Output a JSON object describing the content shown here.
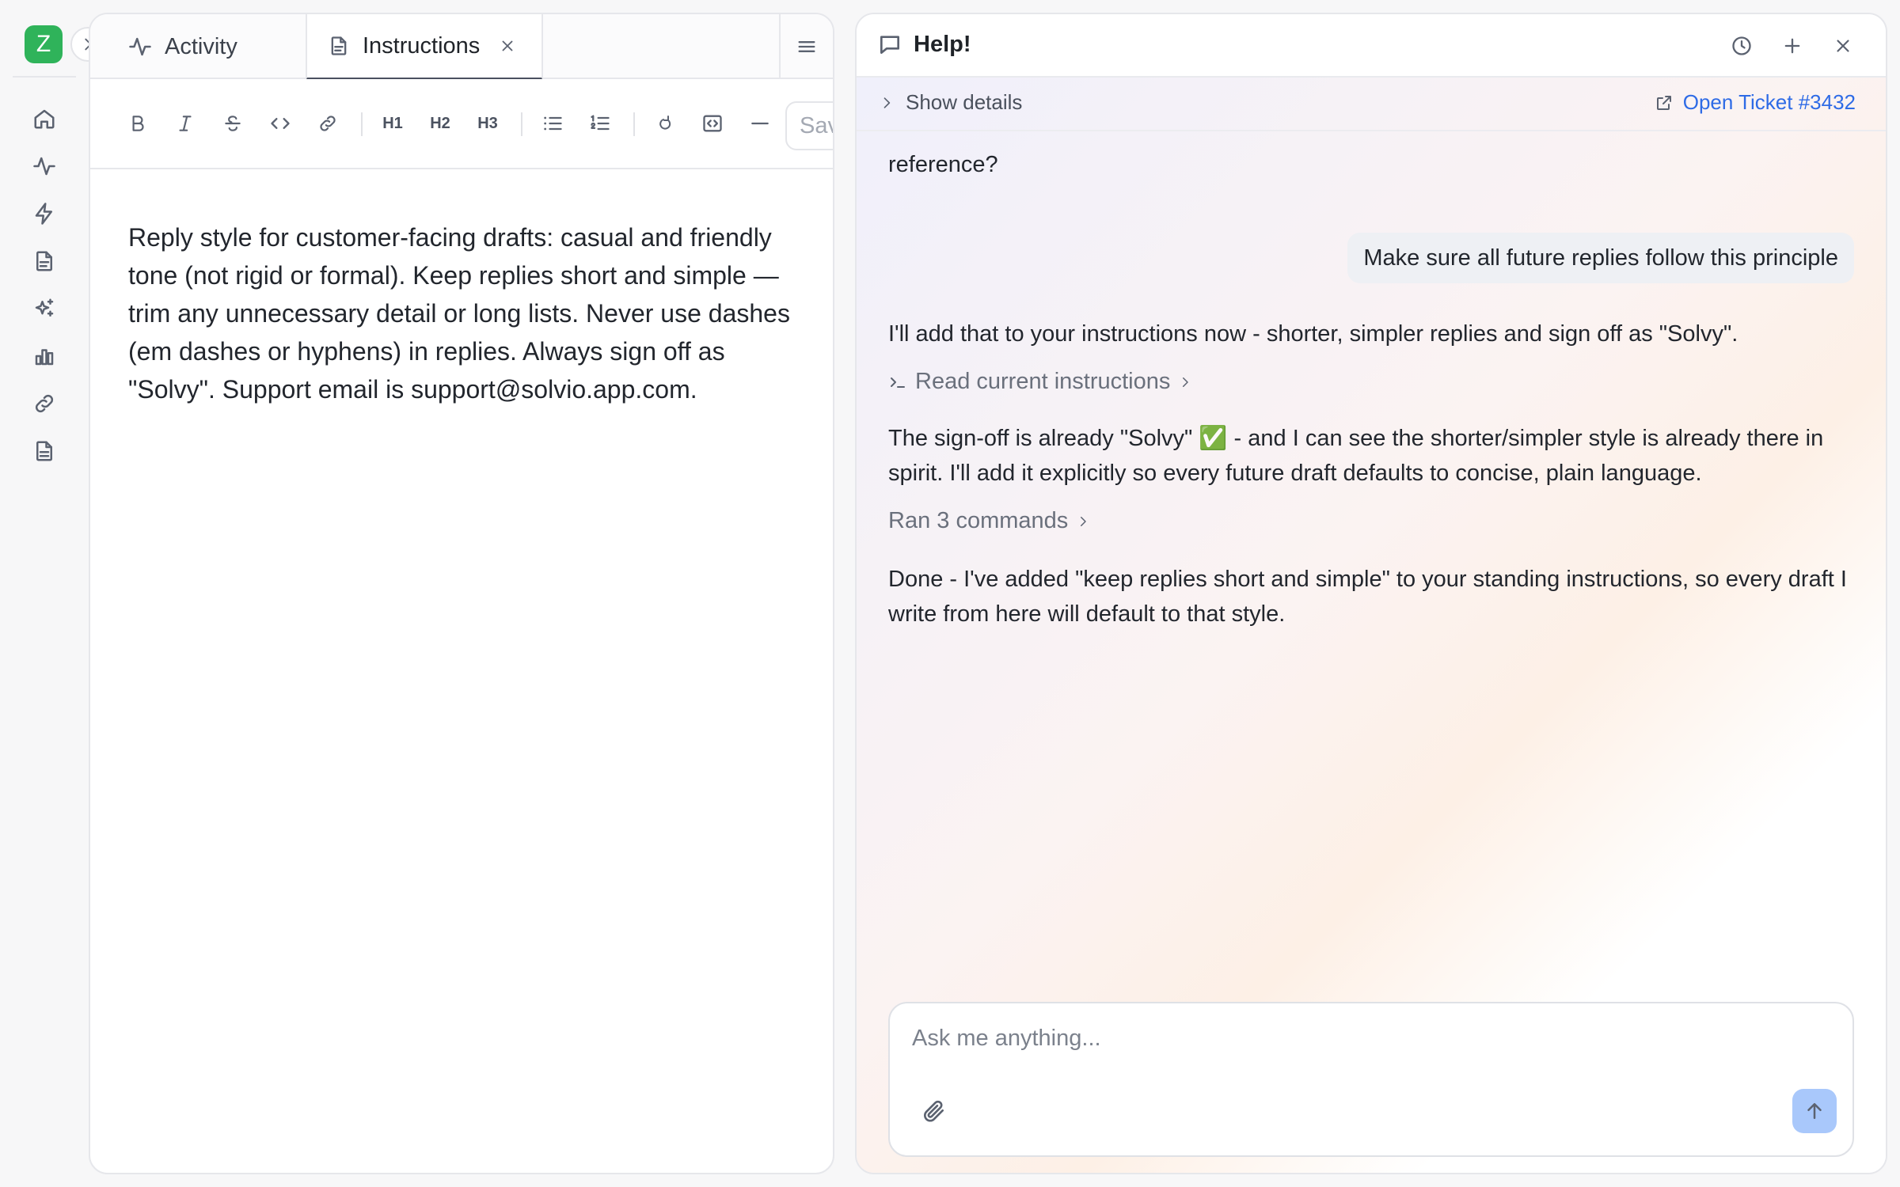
{
  "app": {
    "logo_letter": "Z",
    "brand_color": "#2fb35a"
  },
  "sidebar": {
    "icons": [
      "home-icon",
      "activity-icon",
      "bolt-icon",
      "document-icon",
      "sparkles-icon",
      "bar-chart-icon",
      "link-icon",
      "file-icon"
    ]
  },
  "editor": {
    "tabs": [
      {
        "label": "Activity",
        "icon": "activity-icon",
        "active": false
      },
      {
        "label": "Instructions",
        "icon": "document-icon",
        "active": true
      }
    ],
    "toolbar": {
      "h1": "H1",
      "h2": "H2",
      "h3": "H3",
      "save_label": "Sav"
    },
    "content": "Reply style for customer-facing drafts: casual and friendly tone (not rigid or formal). Keep replies short and simple — trim any unnecessary detail or long lists. Never use dashes (em dashes or hyphens) in replies. Always sign off as \"Solvy\". Support email is support@solvio.app.com."
  },
  "chat": {
    "title": "Help!",
    "show_details_label": "Show details",
    "ticket_link_label": "Open Ticket #3432",
    "link_color": "#2e6be6",
    "messages": {
      "partial_assistant": "reference?",
      "user_1": "Make sure all future replies follow this principle",
      "assistant_1": "I'll add that to your instructions now - shorter, simpler replies and sign off as \"Solvy\".",
      "tool_1": "Read current instructions",
      "assistant_2": "The sign-off is already \"Solvy\" ✅ - and I can see the shorter/simpler style is already there in spirit. I'll add it explicitly so every future draft defaults to concise, plain language.",
      "tool_2": "Ran 3 commands",
      "assistant_3": "Done - I've added \"keep replies short and simple\" to your standing instructions, so every draft I write from here will default to that style."
    },
    "composer": {
      "placeholder": "Ask me anything...",
      "value": ""
    }
  }
}
